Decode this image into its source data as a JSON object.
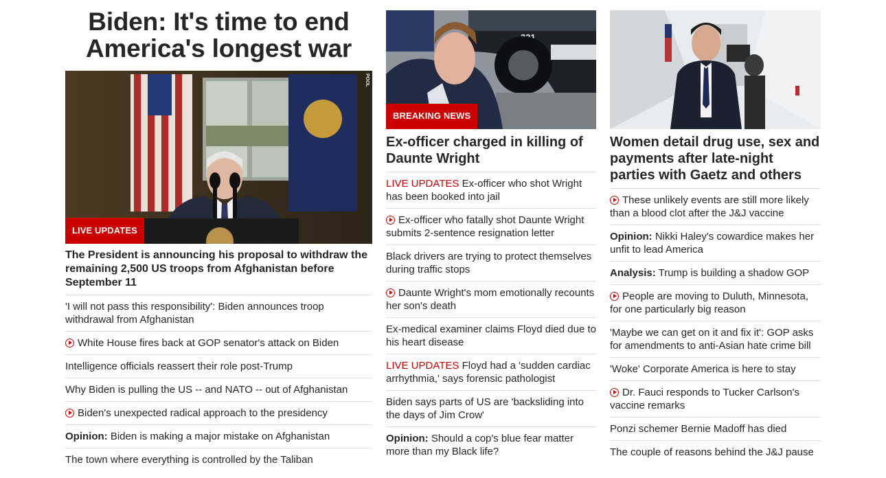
{
  "col1": {
    "headline": "Biden: It's time to end America's longest war",
    "photo_tag": "POOL",
    "badge": "LIVE UPDATES",
    "subhead": "The President is announcing his proposal to withdraw the remaining 2,500 US troops from Afghanistan before September 11",
    "stories": [
      {
        "prefix": "",
        "text": "'I will not pass this responsibility': Biden announces troop withdrawal from Afghanistan",
        "video": false
      },
      {
        "prefix": "",
        "text": "White House fires back at GOP senator's attack on Biden",
        "video": true
      },
      {
        "prefix": "",
        "text": "Intelligence officials reassert their role post-Trump",
        "video": false
      },
      {
        "prefix": "",
        "text": "Why Biden is pulling the US -- and NATO -- out of Afghanistan",
        "video": false
      },
      {
        "prefix": "",
        "text": "Biden's unexpected radical approach to the presidency",
        "video": true
      },
      {
        "prefix": "Opinion:",
        "text": "Biden is making a major mistake on Afghanistan",
        "video": false
      },
      {
        "prefix": "",
        "text": "The town where everything is controlled by the Taliban",
        "video": false
      }
    ]
  },
  "col2": {
    "photo_text": "331",
    "badge": "BREAKING NEWS",
    "headline": "Ex-officer charged in killing of Daunte Wright",
    "stories": [
      {
        "live": "LIVE UPDATES",
        "prefix": "",
        "text": "Ex-officer who shot Wright has been booked into jail",
        "video": false
      },
      {
        "live": "",
        "prefix": "",
        "text": "Ex-officer who fatally shot Daunte Wright submits 2-sentence resignation letter",
        "video": true
      },
      {
        "live": "",
        "prefix": "",
        "text": "Black drivers are trying to protect themselves during traffic stops",
        "video": false
      },
      {
        "live": "",
        "prefix": "",
        "text": "Daunte Wright's mom emotionally recounts her son's death",
        "video": true
      },
      {
        "live": "",
        "prefix": "",
        "text": "Ex-medical examiner claims Floyd died due to his heart disease",
        "video": false
      },
      {
        "live": "LIVE UPDATES",
        "prefix": "",
        "text": "Floyd had a 'sudden cardiac arrhythmia,' says forensic pathologist",
        "video": false
      },
      {
        "live": "",
        "prefix": "",
        "text": "Biden says parts of US are 'backsliding into the days of Jim Crow'",
        "video": false
      },
      {
        "live": "",
        "prefix": "Opinion:",
        "text": "Should a cop's blue fear matter more than my Black life?",
        "video": false
      }
    ]
  },
  "col3": {
    "headline": "Women detail drug use, sex and payments after late-night parties with Gaetz and others",
    "stories": [
      {
        "prefix": "",
        "text": "These unlikely events are still more likely than a blood clot after the J&J vaccine",
        "video": true
      },
      {
        "prefix": "Opinion:",
        "text": "Nikki Haley's cowardice makes her unfit to lead America",
        "video": false
      },
      {
        "prefix": "Analysis:",
        "text": "Trump is building a shadow GOP",
        "video": false
      },
      {
        "prefix": "",
        "text": "People are moving to Duluth, Minnesota, for one particularly big reason",
        "video": true
      },
      {
        "prefix": "",
        "text": "'Maybe we can get on it and fix it': GOP asks for amendments to anti-Asian hate crime bill",
        "video": false
      },
      {
        "prefix": "",
        "text": "'Woke' Corporate America is here to stay",
        "video": false
      },
      {
        "prefix": "",
        "text": "Dr. Fauci responds to Tucker Carlson's vaccine remarks",
        "video": true
      },
      {
        "prefix": "",
        "text": "Ponzi schemer Bernie Madoff has died",
        "video": false
      },
      {
        "prefix": "",
        "text": "The couple of reasons behind the J&J pause",
        "video": false
      }
    ]
  },
  "colors": {
    "accent": "#cc0000",
    "text": "#262626",
    "divider": "#dedede"
  }
}
